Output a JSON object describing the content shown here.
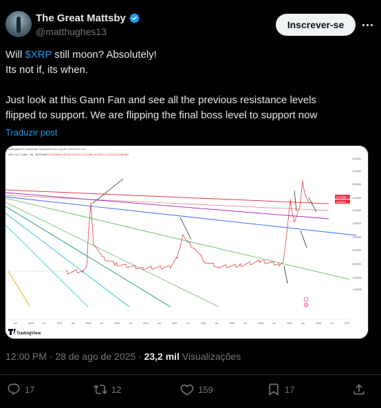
{
  "author": {
    "display_name": "The Great Mattsby",
    "handle": "@matthughes13",
    "verified_icon": "verified-badge-icon",
    "verified_color": "#1d9bf0"
  },
  "follow_label": "Inscrever-se",
  "tweet": {
    "line1_prefix": "Will ",
    "cashtag": "$XRP",
    "line1_suffix": " still moon? Absolutely!",
    "line2": "Its not if, its when.",
    "line3": "Just look at this Gann Fan and see all the previous resistance levels",
    "line4": "flipped to support. We are flipping the final boss level to support now"
  },
  "translate_label": "Traduzir post",
  "chart_image": {
    "header_line1": "matthughes13 created with TradingView.com, Aug 28, 2025 15:02 UTC",
    "header_line2": "XRP / U.S. Dollar · 1W · BITSTAMP",
    "ohlc": "O2.83298 H2.93128 L2.82270 C2.87908 +0.00910 (+0.32%) VOL88.56M",
    "y_ticks": [
      "5.00000",
      "4.00000",
      "3.00000",
      "2.50000",
      "2.00000",
      "1.50000",
      "1.00000",
      "0.50000",
      "0.00000",
      "-0.50000",
      "-1.00000"
    ],
    "x_ticks": [
      "Jul",
      "2016",
      "Jul",
      "2017",
      "Jul",
      "2018",
      "Jul",
      "2019",
      "Jul",
      "2020",
      "Jul",
      "2021",
      "Jul",
      "2022",
      "Jul",
      "2023",
      "Jul",
      "2024",
      "Jul",
      "2025",
      "Jul",
      "2026",
      "Jul",
      "2027"
    ],
    "price_tag_1": "2.87908",
    "price_tag_2": "2.50000",
    "logo_text": "TradingView",
    "colors": {
      "price": "#d62828",
      "fan_red": "#e53950",
      "fan_purple": "#9c27b0",
      "fan_blue": "#2962ff",
      "fan_green": "#4caf50",
      "fan_teal": "#00897b",
      "fan_cyan": "#00bcd4",
      "fan_orange": "#ff9800",
      "price_tag": "#f23645"
    }
  },
  "meta": {
    "time": "12:00 PM · 28 de ago de 2025 · ",
    "views_count": "23,2 mil",
    "views_label": " Visualizações"
  },
  "actions": {
    "replies": "17",
    "reposts": "12",
    "likes": "159",
    "bookmarks": "17"
  }
}
